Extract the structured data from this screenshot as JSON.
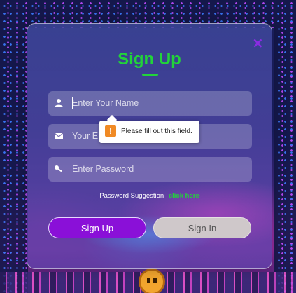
{
  "form": {
    "title": "Sign Up",
    "close_symbol": "×",
    "fields": [
      {
        "icon": "user-icon",
        "placeholder": "Enter Your Name",
        "value": ""
      },
      {
        "icon": "envelope-icon",
        "placeholder": "Your E",
        "value": ""
      },
      {
        "icon": "key-icon",
        "placeholder": "Enter Password",
        "value": ""
      }
    ],
    "tooltip": {
      "icon": "warning-icon",
      "symbol": "!",
      "message": "Please fill out this field."
    },
    "suggestion": {
      "label": "Password Suggestion",
      "link": "click here"
    },
    "buttons": {
      "signup": "Sign Up",
      "signin": "Sign In"
    }
  },
  "colors": {
    "accent_green": "#22d33a",
    "signup_purple": "#8a10d8",
    "signin_gray": "#cfc8ca",
    "warning_orange": "#f08a24"
  }
}
